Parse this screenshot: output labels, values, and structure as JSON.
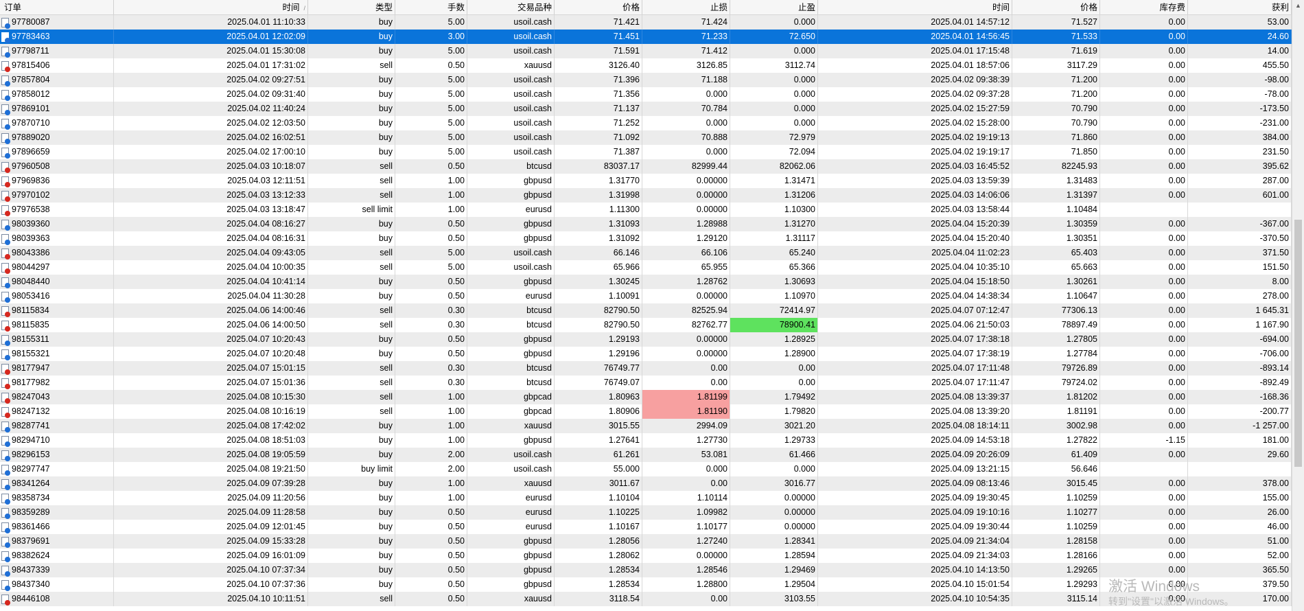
{
  "columns": [
    "订单",
    "时间",
    "类型",
    "手数",
    "交易品种",
    "价格",
    "止损",
    "止盈",
    "时间",
    "价格",
    "库存费",
    "获利"
  ],
  "sort_indicator": "/",
  "colors": {
    "selected_row": "#0a74da",
    "stop_hit": "#f7a0a0",
    "tp_hit": "#5ee25e",
    "buy_icon": "#1f6fd6",
    "sell_icon": "#d6281f"
  },
  "rows": [
    [
      "97780087",
      "2025.04.01 11:10:33",
      "buy",
      "5.00",
      "usoil.cash",
      "71.421",
      "71.424",
      "0.000",
      "2025.04.01 14:57:12",
      "71.527",
      "0.00",
      "53.00"
    ],
    [
      "97783463",
      "2025.04.01 12:02:09",
      "buy",
      "3.00",
      "usoil.cash",
      "71.451",
      "71.233",
      "72.650",
      "2025.04.01 14:56:45",
      "71.533",
      "0.00",
      "24.60"
    ],
    [
      "97798711",
      "2025.04.01 15:30:08",
      "buy",
      "5.00",
      "usoil.cash",
      "71.591",
      "71.412",
      "0.000",
      "2025.04.01 17:15:48",
      "71.619",
      "0.00",
      "14.00"
    ],
    [
      "97815406",
      "2025.04.01 17:31:02",
      "sell",
      "0.50",
      "xauusd",
      "3126.40",
      "3126.85",
      "3112.74",
      "2025.04.01 18:57:06",
      "3117.29",
      "0.00",
      "455.50"
    ],
    [
      "97857804",
      "2025.04.02 09:27:51",
      "buy",
      "5.00",
      "usoil.cash",
      "71.396",
      "71.188",
      "0.000",
      "2025.04.02 09:38:39",
      "71.200",
      "0.00",
      "-98.00"
    ],
    [
      "97858012",
      "2025.04.02 09:31:40",
      "buy",
      "5.00",
      "usoil.cash",
      "71.356",
      "0.000",
      "0.000",
      "2025.04.02 09:37:28",
      "71.200",
      "0.00",
      "-78.00"
    ],
    [
      "97869101",
      "2025.04.02 11:40:24",
      "buy",
      "5.00",
      "usoil.cash",
      "71.137",
      "70.784",
      "0.000",
      "2025.04.02 15:27:59",
      "70.790",
      "0.00",
      "-173.50"
    ],
    [
      "97870710",
      "2025.04.02 12:03:50",
      "buy",
      "5.00",
      "usoil.cash",
      "71.252",
      "0.000",
      "0.000",
      "2025.04.02 15:28:00",
      "70.790",
      "0.00",
      "-231.00"
    ],
    [
      "97889020",
      "2025.04.02 16:02:51",
      "buy",
      "5.00",
      "usoil.cash",
      "71.092",
      "70.888",
      "72.979",
      "2025.04.02 19:19:13",
      "71.860",
      "0.00",
      "384.00"
    ],
    [
      "97896659",
      "2025.04.02 17:00:10",
      "buy",
      "5.00",
      "usoil.cash",
      "71.387",
      "0.000",
      "72.094",
      "2025.04.02 19:19:17",
      "71.850",
      "0.00",
      "231.50"
    ],
    [
      "97960508",
      "2025.04.03 10:18:07",
      "sell",
      "0.50",
      "btcusd",
      "83037.17",
      "82999.44",
      "82062.06",
      "2025.04.03 16:45:52",
      "82245.93",
      "0.00",
      "395.62"
    ],
    [
      "97969836",
      "2025.04.03 12:11:51",
      "sell",
      "1.00",
      "gbpusd",
      "1.31770",
      "0.00000",
      "1.31471",
      "2025.04.03 13:59:39",
      "1.31483",
      "0.00",
      "287.00"
    ],
    [
      "97970102",
      "2025.04.03 13:12:33",
      "sell",
      "1.00",
      "gbpusd",
      "1.31998",
      "0.00000",
      "1.31206",
      "2025.04.03 14:06:06",
      "1.31397",
      "0.00",
      "601.00"
    ],
    [
      "97976538",
      "2025.04.03 13:18:47",
      "sell limit",
      "1.00",
      "eurusd",
      "1.11300",
      "0.00000",
      "1.10300",
      "2025.04.03 13:58:44",
      "1.10484",
      "",
      ""
    ],
    [
      "98039360",
      "2025.04.04 08:16:27",
      "buy",
      "0.50",
      "gbpusd",
      "1.31093",
      "1.28988",
      "1.31270",
      "2025.04.04 15:20:39",
      "1.30359",
      "0.00",
      "-367.00"
    ],
    [
      "98039363",
      "2025.04.04 08:16:31",
      "buy",
      "0.50",
      "gbpusd",
      "1.31092",
      "1.29120",
      "1.31117",
      "2025.04.04 15:20:40",
      "1.30351",
      "0.00",
      "-370.50"
    ],
    [
      "98043386",
      "2025.04.04 09:43:05",
      "sell",
      "5.00",
      "usoil.cash",
      "66.146",
      "66.106",
      "65.240",
      "2025.04.04 11:02:23",
      "65.403",
      "0.00",
      "371.50"
    ],
    [
      "98044297",
      "2025.04.04 10:00:35",
      "sell",
      "5.00",
      "usoil.cash",
      "65.966",
      "65.955",
      "65.366",
      "2025.04.04 10:35:10",
      "65.663",
      "0.00",
      "151.50"
    ],
    [
      "98048440",
      "2025.04.04 10:41:14",
      "buy",
      "0.50",
      "gbpusd",
      "1.30245",
      "1.28762",
      "1.30693",
      "2025.04.04 15:18:50",
      "1.30261",
      "0.00",
      "8.00"
    ],
    [
      "98053416",
      "2025.04.04 11:30:28",
      "buy",
      "0.50",
      "eurusd",
      "1.10091",
      "0.00000",
      "1.10970",
      "2025.04.04 14:38:34",
      "1.10647",
      "0.00",
      "278.00"
    ],
    [
      "98115834",
      "2025.04.06 14:00:46",
      "sell",
      "0.30",
      "btcusd",
      "82790.50",
      "82525.94",
      "72414.97",
      "2025.04.07 07:12:47",
      "77306.13",
      "0.00",
      "1 645.31"
    ],
    [
      "98115835",
      "2025.04.06 14:00:50",
      "sell",
      "0.30",
      "btcusd",
      "82790.50",
      "82762.77",
      "78900.41",
      "2025.04.06 21:50:03",
      "78897.49",
      "0.00",
      "1 167.90"
    ],
    [
      "98155311",
      "2025.04.07 10:20:43",
      "buy",
      "0.50",
      "gbpusd",
      "1.29193",
      "0.00000",
      "1.28925",
      "2025.04.07 17:38:18",
      "1.27805",
      "0.00",
      "-694.00"
    ],
    [
      "98155321",
      "2025.04.07 10:20:48",
      "buy",
      "0.50",
      "gbpusd",
      "1.29196",
      "0.00000",
      "1.28900",
      "2025.04.07 17:38:19",
      "1.27784",
      "0.00",
      "-706.00"
    ],
    [
      "98177947",
      "2025.04.07 15:01:15",
      "sell",
      "0.30",
      "btcusd",
      "76749.77",
      "0.00",
      "0.00",
      "2025.04.07 17:11:48",
      "79726.89",
      "0.00",
      "-893.14"
    ],
    [
      "98177982",
      "2025.04.07 15:01:36",
      "sell",
      "0.30",
      "btcusd",
      "76749.07",
      "0.00",
      "0.00",
      "2025.04.07 17:11:47",
      "79724.02",
      "0.00",
      "-892.49"
    ],
    [
      "98247043",
      "2025.04.08 10:15:30",
      "sell",
      "1.00",
      "gbpcad",
      "1.80963",
      "1.81199",
      "1.79492",
      "2025.04.08 13:39:37",
      "1.81202",
      "0.00",
      "-168.36"
    ],
    [
      "98247132",
      "2025.04.08 10:16:19",
      "sell",
      "1.00",
      "gbpcad",
      "1.80906",
      "1.81190",
      "1.79820",
      "2025.04.08 13:39:20",
      "1.81191",
      "0.00",
      "-200.77"
    ],
    [
      "98287741",
      "2025.04.08 17:42:02",
      "buy",
      "1.00",
      "xauusd",
      "3015.55",
      "2994.09",
      "3021.20",
      "2025.04.08 18:14:11",
      "3002.98",
      "0.00",
      "-1 257.00"
    ],
    [
      "98294710",
      "2025.04.08 18:51:03",
      "buy",
      "1.00",
      "gbpusd",
      "1.27641",
      "1.27730",
      "1.29733",
      "2025.04.09 14:53:18",
      "1.27822",
      "-1.15",
      "181.00"
    ],
    [
      "98296153",
      "2025.04.08 19:05:59",
      "buy",
      "2.00",
      "usoil.cash",
      "61.261",
      "53.081",
      "61.466",
      "2025.04.09 20:26:09",
      "61.409",
      "0.00",
      "29.60"
    ],
    [
      "98297747",
      "2025.04.08 19:21:50",
      "buy limit",
      "2.00",
      "usoil.cash",
      "55.000",
      "0.000",
      "0.000",
      "2025.04.09 13:21:15",
      "56.646",
      "",
      ""
    ],
    [
      "98341264",
      "2025.04.09 07:39:28",
      "buy",
      "1.00",
      "xauusd",
      "3011.67",
      "0.00",
      "3016.77",
      "2025.04.09 08:13:46",
      "3015.45",
      "0.00",
      "378.00"
    ],
    [
      "98358734",
      "2025.04.09 11:20:56",
      "buy",
      "1.00",
      "eurusd",
      "1.10104",
      "1.10114",
      "0.00000",
      "2025.04.09 19:30:45",
      "1.10259",
      "0.00",
      "155.00"
    ],
    [
      "98359289",
      "2025.04.09 11:28:58",
      "buy",
      "0.50",
      "eurusd",
      "1.10225",
      "1.09982",
      "0.00000",
      "2025.04.09 19:10:16",
      "1.10277",
      "0.00",
      "26.00"
    ],
    [
      "98361466",
      "2025.04.09 12:01:45",
      "buy",
      "0.50",
      "eurusd",
      "1.10167",
      "1.10177",
      "0.00000",
      "2025.04.09 19:30:44",
      "1.10259",
      "0.00",
      "46.00"
    ],
    [
      "98379691",
      "2025.04.09 15:33:28",
      "buy",
      "0.50",
      "gbpusd",
      "1.28056",
      "1.27240",
      "1.28341",
      "2025.04.09 21:34:04",
      "1.28158",
      "0.00",
      "51.00"
    ],
    [
      "98382624",
      "2025.04.09 16:01:09",
      "buy",
      "0.50",
      "gbpusd",
      "1.28062",
      "0.00000",
      "1.28594",
      "2025.04.09 21:34:03",
      "1.28166",
      "0.00",
      "52.00"
    ],
    [
      "98437339",
      "2025.04.10 07:37:34",
      "buy",
      "0.50",
      "gbpusd",
      "1.28534",
      "1.28546",
      "1.29469",
      "2025.04.10 14:13:50",
      "1.29265",
      "0.00",
      "365.50"
    ],
    [
      "98437340",
      "2025.04.10 07:37:36",
      "buy",
      "0.50",
      "gbpusd",
      "1.28534",
      "1.28800",
      "1.29504",
      "2025.04.10 15:01:54",
      "1.29293",
      "0.00",
      "379.50"
    ],
    [
      "98446108",
      "2025.04.10 10:11:51",
      "sell",
      "0.50",
      "xauusd",
      "3118.54",
      "0.00",
      "3103.55",
      "2025.04.10 10:54:35",
      "3115.14",
      "0.00",
      "170.00"
    ]
  ],
  "selected_row": 1,
  "stop_highlight_rows": [
    26,
    27
  ],
  "tp_highlight_rows": [
    21
  ],
  "watermark": {
    "line1": "激活 Windows",
    "line2": "转到\"设置\"以激活 Windows。"
  },
  "icons": {
    "row_icon": "order-document-icon",
    "scroll_up": "scroll-up-arrow-icon"
  }
}
